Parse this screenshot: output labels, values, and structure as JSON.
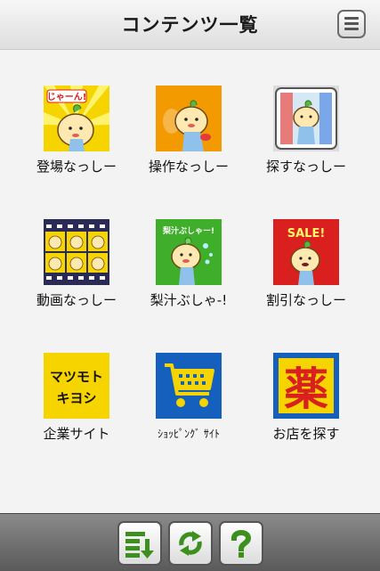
{
  "header": {
    "title": "コンテンツ一覧",
    "menu_icon": "hamburger-menu-icon"
  },
  "tiles": [
    {
      "label": "登場なっしー",
      "icon": "character-appearance-icon"
    },
    {
      "label": "操作なっしー",
      "icon": "character-operation-icon"
    },
    {
      "label": "探すなっしー",
      "icon": "character-search-icon"
    },
    {
      "label": "動画なっしー",
      "icon": "film-strip-icon"
    },
    {
      "label": "梨汁ぶしゃ-!",
      "icon": "pear-juice-splash-icon"
    },
    {
      "label": "割引なっしー",
      "icon": "sale-icon"
    },
    {
      "label": "企業サイト",
      "icon": "matsumoto-kiyoshi-logo-icon"
    },
    {
      "label": "ｼｮｯﾋﾟﾝｸﾞ ｻｲﾄ",
      "icon": "shopping-cart-icon"
    },
    {
      "label": "お店を探す",
      "icon": "pharmacy-kanji-icon"
    }
  ],
  "logos": {
    "splash_text": "じゃーん!",
    "juice_text": "梨汁ぶしゃー!",
    "sale_text": "SALE!",
    "corp_line1": "マツモト",
    "corp_line2": "キヨシ",
    "pharmacy_kanji": "薬"
  },
  "footer": {
    "buttons": [
      {
        "name": "sort-button",
        "icon": "sort-list-icon"
      },
      {
        "name": "refresh-button",
        "icon": "refresh-icon"
      },
      {
        "name": "help-button",
        "icon": "question-mark-icon"
      }
    ]
  },
  "colors": {
    "yellow": "#f5d400",
    "orange": "#f39a00",
    "green": "#3fae2a",
    "red": "#d9201e",
    "blue": "#1560bd",
    "footer_icon_green": "#3d8f1e"
  }
}
